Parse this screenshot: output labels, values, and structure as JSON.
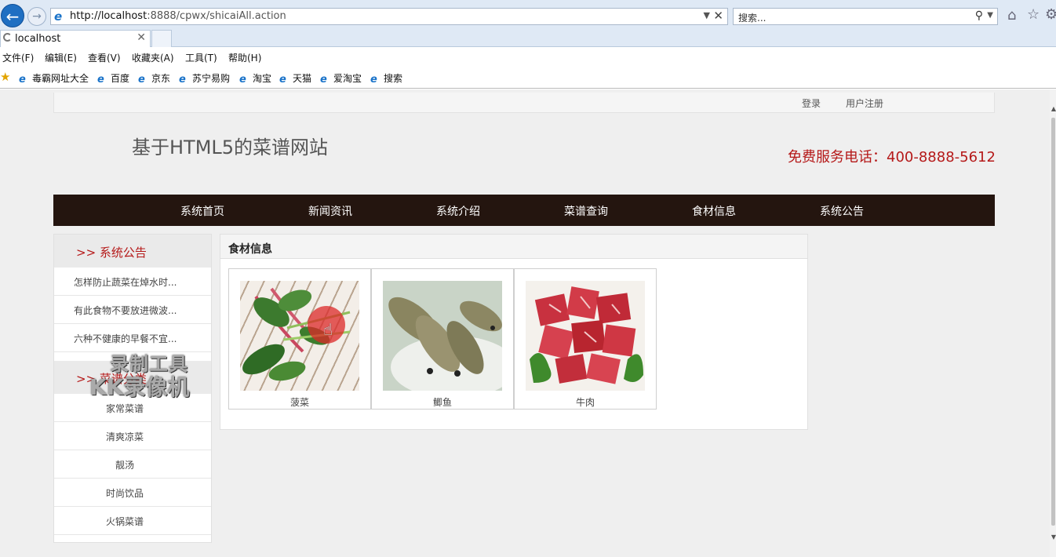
{
  "browser": {
    "url_host": "http://localhost",
    "url_rest": ":8888/cpwx/shicaiAll.action",
    "search_placeholder": "搜索...",
    "tab_title": "localhost",
    "menu": [
      "文件(F)",
      "编辑(E)",
      "查看(V)",
      "收藏夹(A)",
      "工具(T)",
      "帮助(H)"
    ],
    "favorites": [
      "毒霸网址大全",
      "百度",
      "京东",
      "苏宁易购",
      "淘宝",
      "天猫",
      "爱淘宝",
      "搜索"
    ],
    "icons": [
      "back-icon",
      "forward-icon",
      "ie-icon",
      "dropdown-icon",
      "close-icon",
      "search-icon",
      "home-icon",
      "star-icon",
      "gear-icon"
    ]
  },
  "site": {
    "top_links": {
      "login": "登录",
      "register": "用户注册"
    },
    "title": "基于HTML5的菜谱网站",
    "hotline": "免费服务电话：400-8888-5612",
    "nav": [
      "系统首页",
      "新闻资讯",
      "系统介绍",
      "菜谱查询",
      "食材信息",
      "系统公告"
    ],
    "accent_color": "#b51919",
    "nav_bg_color": "#24150f"
  },
  "sidebar": {
    "notice_title": ">> 系统公告",
    "notices": [
      "怎样防止蔬菜在焯水时...",
      "有此食物不要放进微波...",
      "六种不健康的早餐不宜..."
    ],
    "category_title": ">> 菜谱分类",
    "categories": [
      "家常菜谱",
      "清爽凉菜",
      "靓汤",
      "时尚饮品",
      "火锅菜谱"
    ]
  },
  "main": {
    "title": "食材信息",
    "items": [
      {
        "name": "菠菜"
      },
      {
        "name": "鲫鱼"
      },
      {
        "name": "牛肉"
      }
    ]
  },
  "watermark": {
    "line1": "录制工具",
    "line2": "KK录像机"
  }
}
